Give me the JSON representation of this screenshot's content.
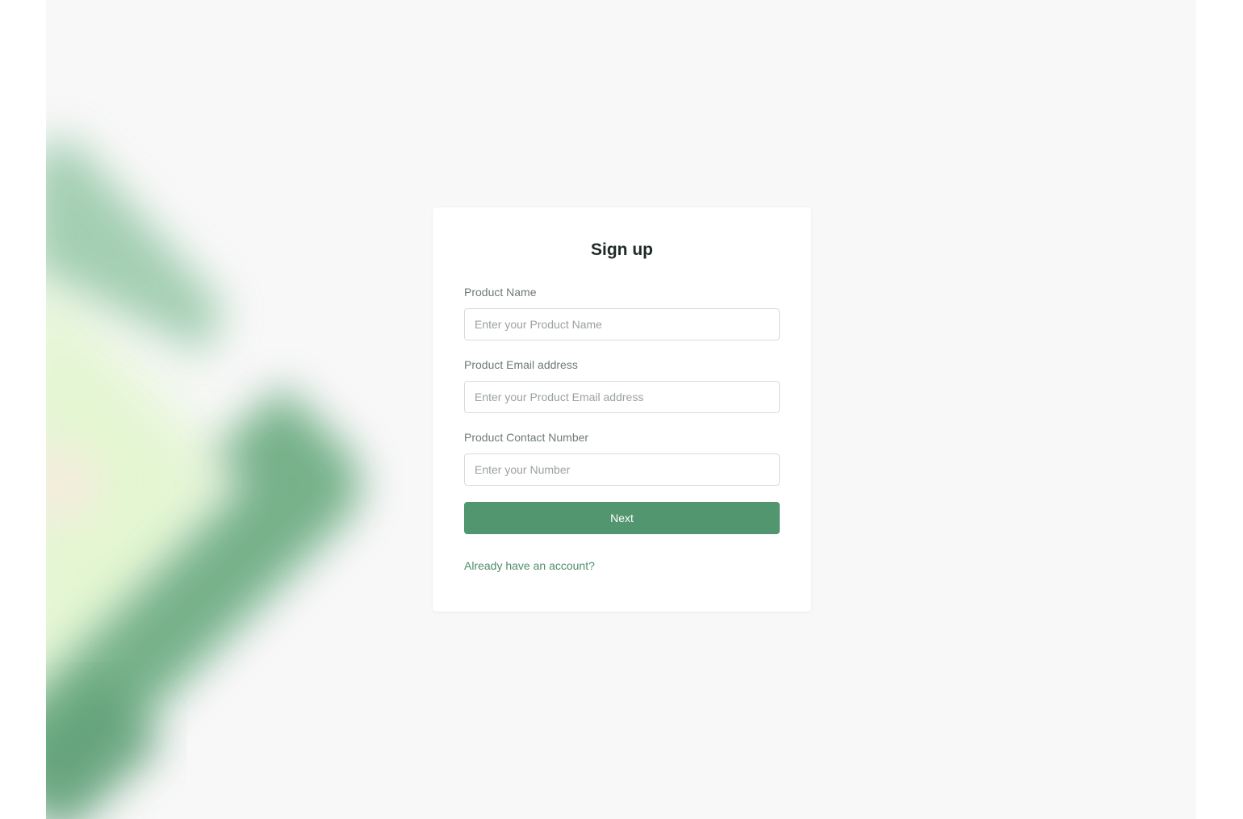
{
  "form": {
    "title": "Sign up",
    "product_name": {
      "label": "Product Name",
      "placeholder": "Enter your Product Name",
      "value": ""
    },
    "product_email": {
      "label": "Product Email address",
      "placeholder": "Enter your Product Email address",
      "value": ""
    },
    "product_contact": {
      "label": "Product Contact Number",
      "placeholder": "Enter your Number",
      "value": ""
    },
    "next_label": "Next",
    "login_link": "Already have an account?"
  },
  "colors": {
    "page_background": "#f8f8f8",
    "card_background": "#ffffff",
    "accent": "#529670",
    "link": "#4e8d69",
    "decor_green": "#6fae85",
    "decor_light_green": "#e2f6cf"
  }
}
